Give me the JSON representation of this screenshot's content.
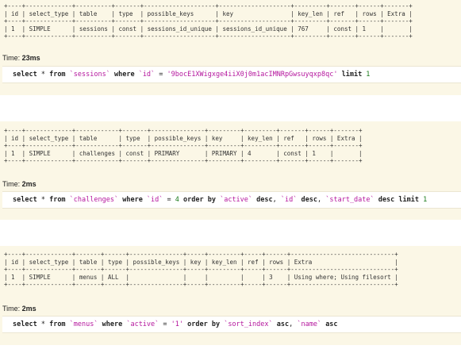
{
  "queries": [
    {
      "explain": "+----+-------------+----------+-------+--------------------+--------------------+---------+-------+------+-------+\n| id | select_type | table    | type  | possible_keys      | key                | key_len | ref   | rows | Extra |\n+----+-------------+----------+-------+--------------------+--------------------+---------+-------+------+-------+\n| 1  | SIMPLE      | sessions | const | sessions_id_unique | sessions_id_unique | 767     | const | 1    |       |\n+----+-------------+----------+-------+--------------------+--------------------+---------+-------+------+-------+",
      "time_label": "Time: ",
      "time_value": "23ms",
      "sql": {
        "t1": "select",
        "t2": " * ",
        "t3": "from",
        "t4": " `sessions` ",
        "t5": "where",
        "t6": " `id` ",
        "t7": "=",
        "t8": " '9bocE1XWigxge4iiX0j0m1acIMNRpGwsuyqxp8qc' ",
        "t9": "limit",
        "t10": " 1"
      }
    },
    {
      "explain": "+----+-------------+------------+-------+---------------+---------+---------+-------+------+-------+\n| id | select_type | table      | type  | possible_keys | key     | key_len | ref   | rows | Extra |\n+----+-------------+------------+-------+---------------+---------+---------+-------+------+-------+\n| 1  | SIMPLE      | challenges | const | PRIMARY       | PRIMARY | 4       | const | 1    |       |\n+----+-------------+------------+-------+---------------+---------+---------+-------+------+-------+",
      "time_label": "Time: ",
      "time_value": "2ms",
      "sql": {
        "t1": "select",
        "t2": " * ",
        "t3": "from",
        "t4": " `challenges` ",
        "t5": "where",
        "t6": " `id` ",
        "t7": "=",
        "t8": " 4 ",
        "t9": "order by",
        "t10": " `active` ",
        "t11": "desc",
        "t12": ", ",
        "t13": "`id`",
        "t14": " ",
        "t15": "desc",
        "t16": ", ",
        "t17": "`start_date`",
        "t18": " ",
        "t19": "desc",
        "t20": " ",
        "t21": "limit",
        "t22": " 1"
      }
    },
    {
      "explain": "+----+-------------+-------+------+---------------+-----+---------+-----+------+-----------------------------+\n| id | select_type | table | type | possible_keys | key | key_len | ref | rows | Extra                       |\n+----+-------------+-------+------+---------------+-----+---------+-----+------+-----------------------------+\n| 1  | SIMPLE      | menus | ALL  |               |     |         |     | 3    | Using where; Using filesort |\n+----+-------------+-------+------+---------------+-----+---------+-----+------+-----------------------------+",
      "time_label": "Time: ",
      "time_value": "2ms",
      "sql": {
        "t1": "select",
        "t2": " * ",
        "t3": "from",
        "t4": " `menus` ",
        "t5": "where",
        "t6": " `active` ",
        "t7": "=",
        "t8": " '1' ",
        "t9": "order by",
        "t10": " `sort_index` ",
        "t11": "asc",
        "t12": ", ",
        "t13": "`name`",
        "t14": " ",
        "t15": "asc"
      }
    }
  ]
}
